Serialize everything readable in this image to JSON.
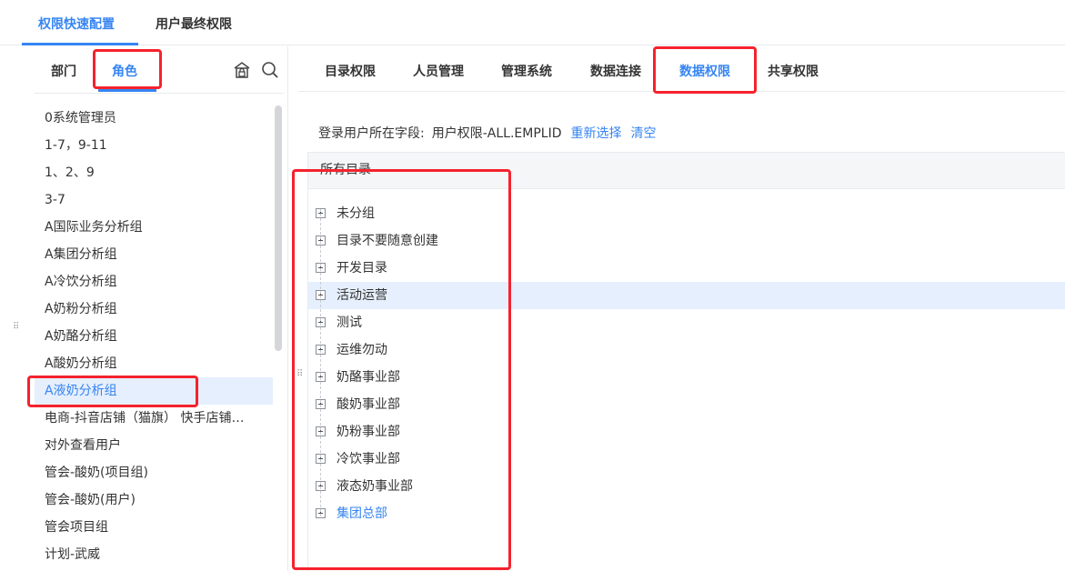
{
  "top_tabs": {
    "quick_config": "权限快速配置",
    "user_final": "用户最终权限"
  },
  "left": {
    "tabs": {
      "department": "部门",
      "role": "角色"
    },
    "icons": {
      "org": "building-lock-icon",
      "search": "search-icon"
    },
    "roles": [
      "0系统管理员",
      "1-7，9-11",
      "1、2、9",
      "3-7",
      "A国际业务分析组",
      "A集团分析组",
      "A冷饮分析组",
      "A奶粉分析组",
      "A奶酪分析组",
      "A酸奶分析组",
      "A液奶分析组",
      "电商-抖音店铺（猫旗） 快手店铺…",
      "对外查看用户",
      "管会-酸奶(项目组)",
      "管会-酸奶(用户)",
      "管会项目组",
      "计划-武威"
    ],
    "selected_role": "A液奶分析组"
  },
  "right": {
    "tabs": {
      "directory": "目录权限",
      "personnel": "人员管理",
      "admin_system": "管理系统",
      "data_connection": "数据连接",
      "data_permission": "数据权限",
      "shared": "共享权限"
    },
    "field": {
      "label": "登录用户所在字段:",
      "value": "用户权限-ALL.EMPLID",
      "reselect": "重新选择",
      "clear": "清空"
    },
    "directory_header": "所有目录",
    "tree": [
      "未分组",
      "目录不要随意创建",
      "开发目录",
      "活动运营",
      "测试",
      "运维勿动",
      "奶酪事业部",
      "酸奶事业部",
      "奶粉事业部",
      "冷饮事业部",
      "液态奶事业部",
      "集团总部"
    ]
  },
  "colors": {
    "accent": "#3685f2",
    "selected_bg": "#e6effd",
    "annotation": "#f5222d"
  }
}
